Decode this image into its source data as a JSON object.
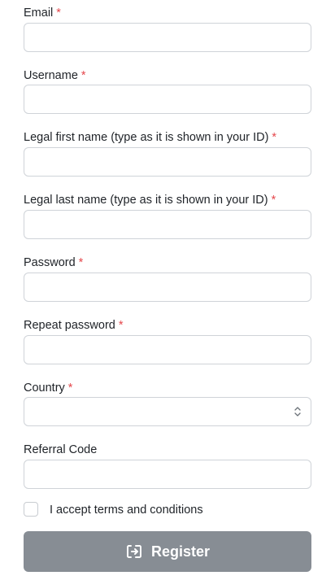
{
  "form": {
    "fields": [
      {
        "label": "Email",
        "required_mark": "*",
        "value": "",
        "placeholder": ""
      },
      {
        "label": "Username",
        "required_mark": "*",
        "value": "",
        "placeholder": ""
      },
      {
        "label": "Legal first name (type as it is shown in your ID)",
        "required_mark": "*",
        "value": "",
        "placeholder": ""
      },
      {
        "label": "Legal last name (type as it is shown in your ID)",
        "required_mark": "*",
        "value": "",
        "placeholder": ""
      },
      {
        "label": "Password",
        "required_mark": "*",
        "value": "",
        "placeholder": ""
      },
      {
        "label": "Repeat password",
        "required_mark": "*",
        "value": "",
        "placeholder": ""
      },
      {
        "label": "Country",
        "required_mark": "*",
        "selected": ""
      },
      {
        "label": "Referral Code",
        "value": "",
        "placeholder": ""
      }
    ],
    "terms": {
      "label": "I accept terms and conditions",
      "checked": false
    },
    "submit": {
      "label": "Register",
      "icon": "login-icon"
    }
  },
  "colors": {
    "required": "#e5484d",
    "button_bg": "#878d94",
    "input_border": "#cfd3d8"
  }
}
